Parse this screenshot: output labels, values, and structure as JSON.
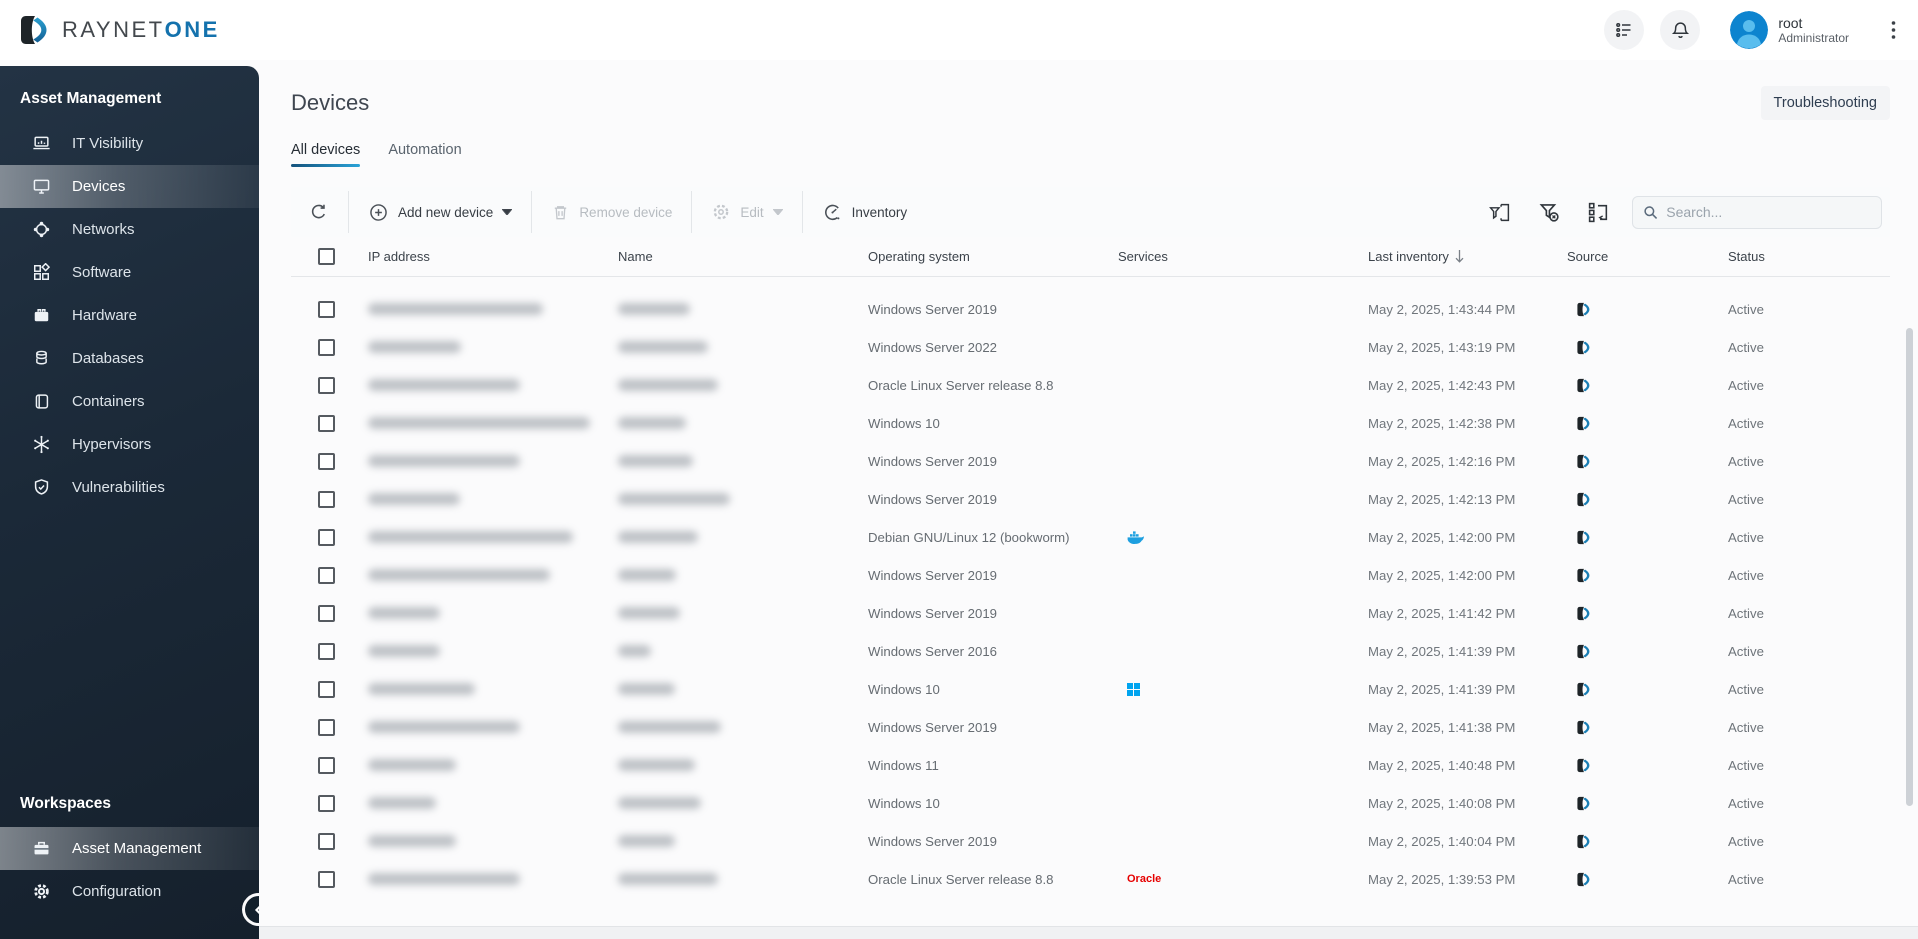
{
  "brand": {
    "name_primary": "RAYNET",
    "name_accent": "ONE"
  },
  "topbar": {
    "user_name": "root",
    "user_role": "Administrator"
  },
  "colors": {
    "accent_blue": "#1472ad",
    "tab_underline_from": "#14527c",
    "tab_underline_to": "#2aa3d8",
    "sidebar_bg": "#1b2938",
    "oracle_red": "#e60000",
    "windows_blue": "#00a4ef",
    "docker_blue": "#1d9fe0"
  },
  "sidebar": {
    "section1_title": "Asset Management",
    "section1_items": [
      {
        "label": "IT Visibility",
        "icon": "it-visibility-icon",
        "active": false
      },
      {
        "label": "Devices",
        "icon": "devices-icon",
        "active": true
      },
      {
        "label": "Networks",
        "icon": "networks-icon",
        "active": false
      },
      {
        "label": "Software",
        "icon": "software-icon",
        "active": false
      },
      {
        "label": "Hardware",
        "icon": "hardware-icon",
        "active": false
      },
      {
        "label": "Databases",
        "icon": "databases-icon",
        "active": false
      },
      {
        "label": "Containers",
        "icon": "containers-icon",
        "active": false
      },
      {
        "label": "Hypervisors",
        "icon": "hypervisors-icon",
        "active": false
      },
      {
        "label": "Vulnerabilities",
        "icon": "vulnerabilities-icon",
        "active": false
      }
    ],
    "section2_title": "Workspaces",
    "section2_items": [
      {
        "label": "Asset Management",
        "icon": "briefcase-icon",
        "active": true
      },
      {
        "label": "Configuration",
        "icon": "gear-icon",
        "active": false
      }
    ]
  },
  "page": {
    "title": "Devices",
    "troubleshooting_label": "Troubleshooting",
    "tabs": [
      {
        "label": "All devices",
        "active": true
      },
      {
        "label": "Automation",
        "active": false
      }
    ]
  },
  "toolbar": {
    "add_new_device": "Add new device",
    "remove_device": "Remove device",
    "edit": "Edit",
    "inventory": "Inventory",
    "search_placeholder": "Search..."
  },
  "table": {
    "columns": [
      "IP address",
      "Name",
      "Operating system",
      "Services",
      "Last inventory",
      "Source",
      "Status"
    ],
    "sorted_column": "Last inventory",
    "sort_direction": "desc",
    "rows": [
      {
        "os": "Windows Server 2019",
        "service": "",
        "last_inventory": "May 2, 2025, 1:43:44 PM",
        "source": "raynet",
        "status": "Active",
        "ip_blur_w": 175,
        "name_blur_w": 72
      },
      {
        "os": "Windows Server 2022",
        "service": "",
        "last_inventory": "May 2, 2025, 1:43:19 PM",
        "source": "raynet",
        "status": "Active",
        "ip_blur_w": 93,
        "name_blur_w": 90
      },
      {
        "os": "Oracle Linux Server release 8.8",
        "service": "",
        "last_inventory": "May 2, 2025, 1:42:43 PM",
        "source": "raynet",
        "status": "Active",
        "ip_blur_w": 152,
        "name_blur_w": 100
      },
      {
        "os": "Windows 10",
        "service": "",
        "last_inventory": "May 2, 2025, 1:42:38 PM",
        "source": "raynet",
        "status": "Active",
        "ip_blur_w": 222,
        "name_blur_w": 68
      },
      {
        "os": "Windows Server 2019",
        "service": "",
        "last_inventory": "May 2, 2025, 1:42:16 PM",
        "source": "raynet",
        "status": "Active",
        "ip_blur_w": 152,
        "name_blur_w": 75
      },
      {
        "os": "Windows Server 2019",
        "service": "",
        "last_inventory": "May 2, 2025, 1:42:13 PM",
        "source": "raynet",
        "status": "Active",
        "ip_blur_w": 92,
        "name_blur_w": 112
      },
      {
        "os": "Debian GNU/Linux 12 (bookworm)",
        "service": "docker",
        "last_inventory": "May 2, 2025, 1:42:00 PM",
        "source": "raynet",
        "status": "Active",
        "ip_blur_w": 205,
        "name_blur_w": 80
      },
      {
        "os": "Windows Server 2019",
        "service": "",
        "last_inventory": "May 2, 2025, 1:42:00 PM",
        "source": "raynet",
        "status": "Active",
        "ip_blur_w": 182,
        "name_blur_w": 58
      },
      {
        "os": "Windows Server 2019",
        "service": "",
        "last_inventory": "May 2, 2025, 1:41:42 PM",
        "source": "raynet",
        "status": "Active",
        "ip_blur_w": 72,
        "name_blur_w": 62
      },
      {
        "os": "Windows Server 2016",
        "service": "",
        "last_inventory": "May 2, 2025, 1:41:39 PM",
        "source": "raynet",
        "status": "Active",
        "ip_blur_w": 72,
        "name_blur_w": 33
      },
      {
        "os": "Windows 10",
        "service": "windows",
        "last_inventory": "May 2, 2025, 1:41:39 PM",
        "source": "raynet",
        "status": "Active",
        "ip_blur_w": 107,
        "name_blur_w": 57
      },
      {
        "os": "Windows Server 2019",
        "service": "",
        "last_inventory": "May 2, 2025, 1:41:38 PM",
        "source": "raynet",
        "status": "Active",
        "ip_blur_w": 152,
        "name_blur_w": 103
      },
      {
        "os": "Windows 11",
        "service": "",
        "last_inventory": "May 2, 2025, 1:40:48 PM",
        "source": "raynet",
        "status": "Active",
        "ip_blur_w": 88,
        "name_blur_w": 77
      },
      {
        "os": "Windows 10",
        "service": "",
        "last_inventory": "May 2, 2025, 1:40:08 PM",
        "source": "raynet",
        "status": "Active",
        "ip_blur_w": 68,
        "name_blur_w": 83
      },
      {
        "os": "Windows Server 2019",
        "service": "",
        "last_inventory": "May 2, 2025, 1:40:04 PM",
        "source": "raynet",
        "status": "Active",
        "ip_blur_w": 88,
        "name_blur_w": 57
      },
      {
        "os": "Oracle Linux Server release 8.8",
        "service": "oracle",
        "service_label": "Oracle",
        "last_inventory": "May 2, 2025, 1:39:53 PM",
        "source": "raynet",
        "status": "Active",
        "ip_blur_w": 152,
        "name_blur_w": 100
      }
    ]
  }
}
